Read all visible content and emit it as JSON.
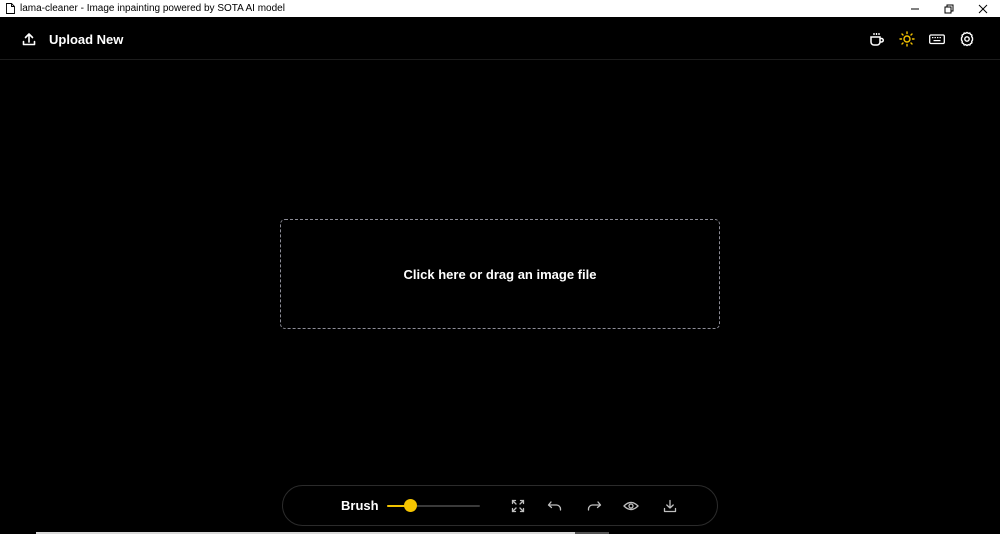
{
  "window": {
    "title": "lama-cleaner - Image inpainting powered by SOTA AI model",
    "controls": [
      "minimize",
      "restore",
      "close"
    ]
  },
  "header": {
    "upload_label": "Upload New",
    "icons": [
      "coffee-icon",
      "sun-icon",
      "keyboard-icon",
      "settings-icon"
    ]
  },
  "dropzone": {
    "text": "Click here or drag an image file"
  },
  "toolbar": {
    "brush_label": "Brush",
    "brush_size_fraction": 0.21,
    "buttons": [
      "fit-screen-icon",
      "undo-icon",
      "redo-icon",
      "eye-icon",
      "download-icon"
    ]
  },
  "colors": {
    "background": "#000000",
    "accent": "#f5c400",
    "dropzone_border": "#8c8c96"
  }
}
